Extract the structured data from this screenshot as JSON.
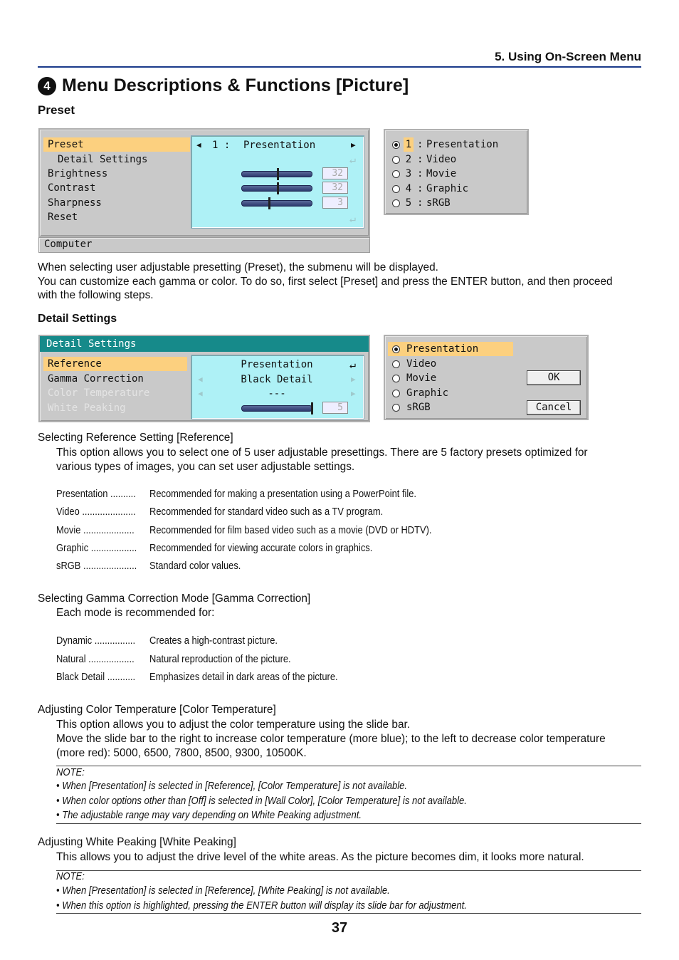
{
  "header": {
    "section": "5. Using On-Screen Menu",
    "title_number": "4",
    "title": "Menu Descriptions & Functions [Picture]"
  },
  "preset_section": {
    "heading": "Preset",
    "menu": {
      "items": [
        {
          "label": "Preset",
          "highlighted": true
        },
        {
          "label": "Detail Settings",
          "indented": true
        },
        {
          "label": "Brightness"
        },
        {
          "label": "Contrast"
        },
        {
          "label": "Sharpness"
        },
        {
          "label": "Reset"
        }
      ],
      "preset_value_prefix": "1 :",
      "preset_value": "Presentation",
      "sliders": [
        {
          "name": "Brightness",
          "value": "32",
          "level": 0.5
        },
        {
          "name": "Contrast",
          "value": "32",
          "level": 0.5
        },
        {
          "name": "Sharpness",
          "value": "3",
          "level": 0.38
        }
      ],
      "status_bar": "Computer"
    },
    "list": {
      "items": [
        {
          "num": "1",
          "label": "Presentation",
          "selected": true
        },
        {
          "num": "2",
          "label": "Video"
        },
        {
          "num": "3",
          "label": "Movie"
        },
        {
          "num": "4",
          "label": "Graphic"
        },
        {
          "num": "5",
          "label": "sRGB"
        }
      ],
      "separator": ":"
    },
    "paragraph": [
      "When selecting user adjustable presetting (Preset), the submenu will be displayed.",
      "You can customize each gamma or color. To do so, first select [Preset] and press the ENTER button, and then proceed",
      "with the following steps."
    ]
  },
  "detail_section": {
    "heading": "Detail Settings",
    "menu": {
      "title": "Detail Settings",
      "items": [
        {
          "label": "Reference",
          "highlighted": true
        },
        {
          "label": "Gamma Correction"
        },
        {
          "label": "Color Temperature",
          "disabled": true
        },
        {
          "label": "White Peaking",
          "disabled": true
        }
      ],
      "values": [
        "Presentation",
        "Black Detail",
        "---"
      ],
      "slider": {
        "value": "5",
        "level": 1.0
      }
    },
    "dialog": {
      "options": [
        {
          "label": "Presentation",
          "selected": true
        },
        {
          "label": "Video"
        },
        {
          "label": "Movie"
        },
        {
          "label": "Graphic"
        },
        {
          "label": "sRGB"
        }
      ],
      "ok_label": "OK",
      "cancel_label": "Cancel"
    }
  },
  "reference": {
    "heading": "Selecting Reference Setting [Reference]",
    "body": [
      "This option allows you to select one of 5 user adjustable presettings. There are 5 factory presets optimized for",
      "various types of images, you can set user adjustable settings."
    ],
    "definitions": [
      {
        "term": "Presentation ..........",
        "desc": "Recommended for making a presentation using a PowerPoint file."
      },
      {
        "term": "Video .....................",
        "desc": "Recommended for standard video such as a TV program."
      },
      {
        "term": "Movie ....................",
        "desc": "Recommended for film based video such as a movie (DVD or HDTV)."
      },
      {
        "term": "Graphic ..................",
        "desc": "Recommended for viewing accurate colors in graphics."
      },
      {
        "term": "sRGB .....................",
        "desc": "Standard color values."
      }
    ]
  },
  "gamma": {
    "heading": "Selecting Gamma Correction Mode [Gamma Correction]",
    "body": "Each mode is recommended for:",
    "definitions": [
      {
        "term": "Dynamic ................",
        "desc": "Creates a high-contrast picture."
      },
      {
        "term": "Natural ..................",
        "desc": "Natural reproduction of the picture."
      },
      {
        "term": "Black Detail ...........",
        "desc": "Emphasizes detail in dark areas of the picture."
      }
    ]
  },
  "color_temp": {
    "heading": "Adjusting Color Temperature [Color Temperature]",
    "body": [
      "This option allows you to adjust the color temperature using the slide bar.",
      "Move the slide bar to the right to increase color temperature (more blue); to the left to decrease color temperature",
      "(more red): 5000, 6500, 7800, 8500, 9300, 10500K."
    ],
    "note_label": "NOTE:",
    "notes": [
      "When [Presentation] is selected in [Reference], [Color Temperature] is not available.",
      "When color options other than [Off] is selected in [Wall Color], [Color Temperature] is not available.",
      "The adjustable range may vary depending on White Peaking adjustment."
    ]
  },
  "white_peaking": {
    "heading": "Adjusting White Peaking [White Peaking]",
    "body": "This allows you to adjust the drive level of the white areas. As the picture becomes dim, it looks more natural.",
    "note_label": "NOTE:",
    "notes": [
      "When [Presentation] is selected in [Reference], [White Peaking] is not available.",
      "When this option is highlighted, pressing the ENTER button will display its slide bar for adjustment."
    ]
  },
  "page_number": "37",
  "icons": {
    "left_arrow": "◀",
    "right_arrow": "▶",
    "enter": "↵",
    "bullet": "•"
  }
}
